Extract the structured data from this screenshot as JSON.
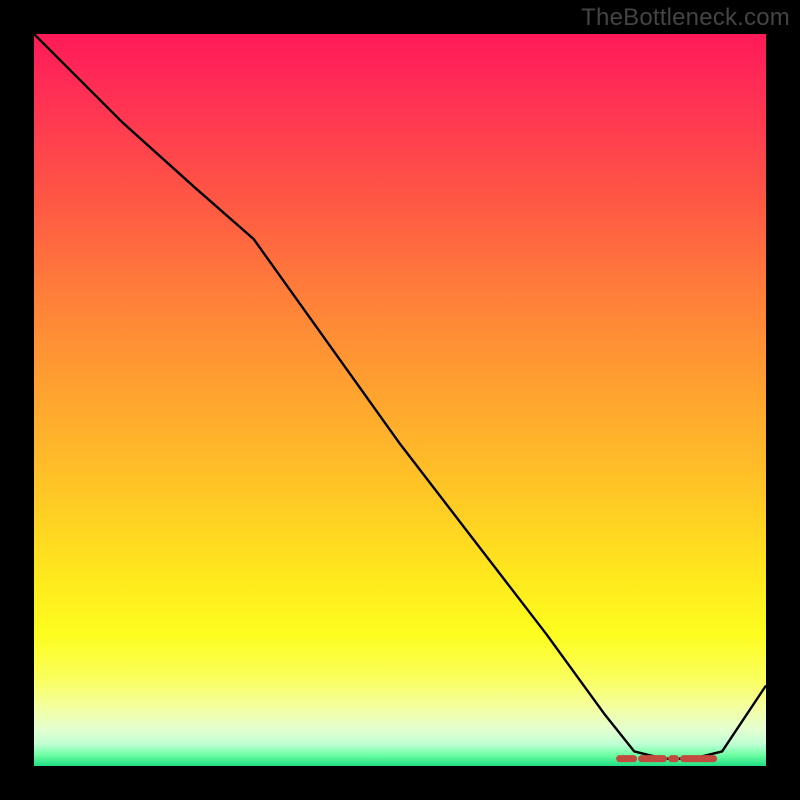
{
  "attribution": "TheBottleneck.com",
  "colors": {
    "gradient_top": "#ff1a58",
    "gradient_bottom": "#1fdd82",
    "curve": "#000000",
    "marker": "#c24a3e",
    "frame": "#000000"
  },
  "chart_data": {
    "type": "line",
    "title": "",
    "xlabel": "",
    "ylabel": "",
    "xlim": [
      0,
      100
    ],
    "ylim": [
      0,
      100
    ],
    "series": [
      {
        "name": "bottleneck-curve",
        "x": [
          0,
          12,
          22,
          30,
          40,
          50,
          60,
          70,
          78,
          82,
          86,
          90,
          94,
          100
        ],
        "values": [
          100,
          88,
          79,
          72,
          58,
          44,
          31,
          18,
          7,
          2,
          1,
          1,
          2,
          11
        ]
      }
    ],
    "annotations": [
      {
        "name": "optimal-flat-segment",
        "x_start": 80,
        "x_end": 93,
        "y": 1
      }
    ]
  }
}
